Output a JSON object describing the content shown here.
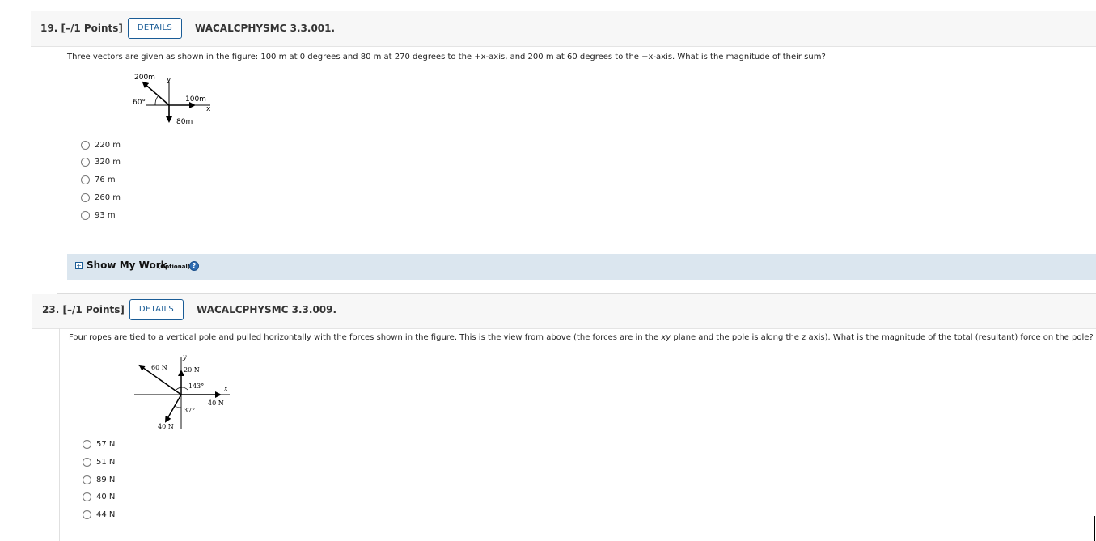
{
  "questions": [
    {
      "number": "19.",
      "points": "[–/1 Points]",
      "details_label": "DETAILS",
      "code": "WACALCPHYSMC 3.3.001.",
      "prompt": "Three vectors are given as shown in the figure: 100 m at 0 degrees and 80 m at 270 degrees to the +x-axis, and 200 m at 60 degrees to the −x-axis. What is the magnitude of their sum?",
      "figure_labels": {
        "v200": "200m",
        "yaxis": "y",
        "angle": "60°",
        "v100": "100m",
        "xaxis": "x",
        "v80": "80m"
      },
      "options": [
        "220 m",
        "320 m",
        "76 m",
        "260 m",
        "93 m"
      ],
      "show_my_work": {
        "label": "Show My Work",
        "optional": "(Optional)",
        "help": "?"
      }
    },
    {
      "number": "23.",
      "points": "[–/1 Points]",
      "details_label": "DETAILS",
      "code": "WACALCPHYSMC 3.3.009.",
      "prompt_parts": {
        "a": "Four ropes are tied to a vertical pole and pulled horizontally with the forces shown in the figure. This is the view from above (the forces are in the ",
        "b": "xy",
        "c": " plane and the pole is along the ",
        "d": "z",
        "e": " axis). What is the magnitude of the total (resultant) force on the pole?"
      },
      "figure_labels": {
        "yaxis": "y",
        "f60": "60 N",
        "f20": "20 N",
        "angle143": "143°",
        "xaxis": "x",
        "f40r": "40 N",
        "angle37": "37°",
        "f40b": "40 N"
      },
      "options": [
        "57 N",
        "51 N",
        "89 N",
        "40 N",
        "44 N"
      ]
    }
  ]
}
